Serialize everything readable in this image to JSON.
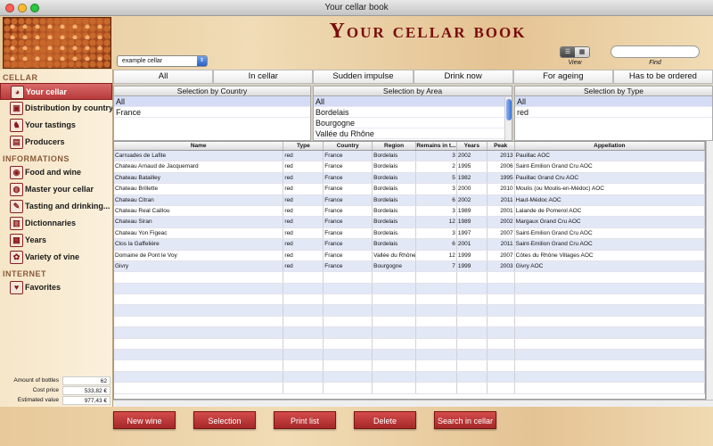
{
  "window": {
    "title": "Your cellar book"
  },
  "header": {
    "app_title": "Your cellar book",
    "cellar_select": "example cellar",
    "view_label": "View",
    "find_label": "Find",
    "find_value": ""
  },
  "sidebar": {
    "sections": [
      {
        "title": "CELLAR",
        "items": [
          {
            "label": "Your cellar",
            "icon": "wine-glass-icon"
          },
          {
            "label": "Distribution by country",
            "icon": "map-icon"
          },
          {
            "label": "Your tastings",
            "icon": "tasting-icon"
          },
          {
            "label": "Producers",
            "icon": "producer-icon"
          }
        ]
      },
      {
        "title": "INFORMATIONS",
        "items": [
          {
            "label": "Food and wine",
            "icon": "food-icon"
          },
          {
            "label": "Master your cellar",
            "icon": "cellar-icon"
          },
          {
            "label": "Tasting and drinking...",
            "icon": "drinking-icon"
          },
          {
            "label": "Dictionnaries",
            "icon": "book-icon"
          },
          {
            "label": "Years",
            "icon": "calendar-icon"
          },
          {
            "label": "Variety of vine",
            "icon": "grape-icon"
          }
        ]
      },
      {
        "title": "INTERNET",
        "items": [
          {
            "label": "Favorites",
            "icon": "web-icon"
          }
        ]
      }
    ],
    "summary": [
      {
        "label": "Amount of bottles",
        "value": "62"
      },
      {
        "label": "Cost price",
        "value": "533,82 €"
      },
      {
        "label": "Estimated value",
        "value": "977,43 €"
      }
    ]
  },
  "tabs": [
    "All",
    "In cellar",
    "Sudden impulse",
    "Drink now",
    "For ageing",
    "Has to be ordered"
  ],
  "filters": [
    {
      "title": "Selection by Country",
      "items": [
        "All",
        "France"
      ]
    },
    {
      "title": "Selection by Area",
      "items": [
        "All",
        "Bordelais",
        "Bourgogne",
        "Vallée du Rhône"
      ]
    },
    {
      "title": "Selection by Type",
      "items": [
        "All",
        "red"
      ]
    }
  ],
  "table": {
    "columns": [
      "Name",
      "Type",
      "Country",
      "Region",
      "Remains in t...",
      "Years",
      "Peak",
      "Appellation"
    ],
    "rows": [
      [
        "Carruades de Lafite",
        "red",
        "France",
        "Bordelais",
        "3",
        "2002",
        "2013",
        "Pauillac AOC"
      ],
      [
        "Chateau Arnaud de Jacquemard",
        "red",
        "France",
        "Bordelais",
        "2",
        "1995",
        "2006",
        "Saint-Emilion Grand Cru AOC"
      ],
      [
        "Chateau Batailley",
        "red",
        "France",
        "Bordelais",
        "5",
        "1982",
        "1995",
        "Pauillac Grand Cru AOC"
      ],
      [
        "Chateau Brillette",
        "red",
        "France",
        "Bordelais",
        "3",
        "2000",
        "2010",
        "Moulis (ou Moulis-en-Médoc) AOC"
      ],
      [
        "Chateau Citran",
        "red",
        "France",
        "Bordelais",
        "6",
        "2002",
        "2011",
        "Haut-Médoc AOC"
      ],
      [
        "Chateau Real Caillou",
        "red",
        "France",
        "Bordelais",
        "3",
        "1989",
        "2001",
        "Lalande de Pomerol AOC"
      ],
      [
        "Chateau Siran",
        "red",
        "France",
        "Bordelais",
        "12",
        "1989",
        "2002",
        "Margaux Grand Cru AOC"
      ],
      [
        "Chateau Yon Figeac",
        "red",
        "France",
        "Bordelais",
        "3",
        "1997",
        "2007",
        "Saint-Emilion Grand Cru AOC"
      ],
      [
        "Clos la Gaffelière",
        "red",
        "France",
        "Bordelais",
        "6",
        "2001",
        "2011",
        "Saint-Emilion Grand Cru AOC"
      ],
      [
        "Domaine de Pont le Voy",
        "red",
        "France",
        "Vallée du Rhône",
        "12",
        "1999",
        "2007",
        "Côtes du Rhône Villages AOC"
      ],
      [
        "Givry",
        "red",
        "France",
        "Bourgogne",
        "7",
        "1999",
        "2003",
        "Givry AOC"
      ]
    ]
  },
  "buttons": [
    "New   wine",
    "Selection",
    "Print list",
    "Delete",
    "Search in cellar"
  ]
}
